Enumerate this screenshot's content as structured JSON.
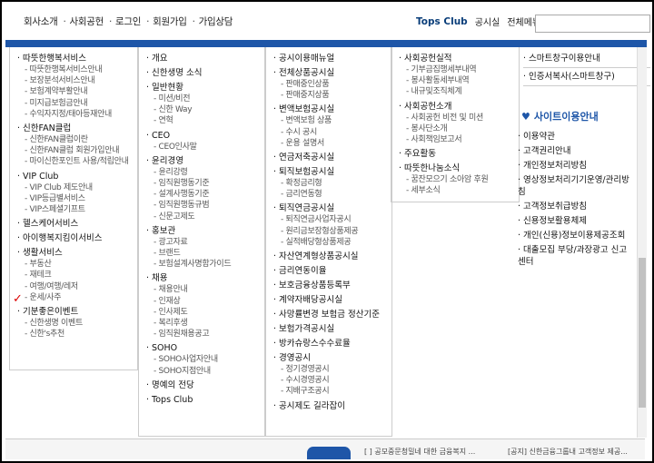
{
  "topnav": [
    "회사소개",
    "사회공헌",
    "로그인",
    "회원가입",
    "가입상담"
  ],
  "topright": {
    "tops": "Tops Club",
    "notice": "공시실",
    "menu": "전체메뉴"
  },
  "col1": [
    {
      "h": "따뜻한행복서비스",
      "subs": [
        "따뜻한행복서비스안내",
        "보장분석서비스안내",
        "보험계약부활안내",
        "미지급보험금안내",
        "수익자지정/태아등재안내"
      ]
    },
    {
      "h": "신한FAN클럽",
      "subs": [
        "신한FAN클럽이란",
        "신한FAN클럽 회원가입안내",
        "마이신한포인트 사용/적립안내"
      ]
    },
    {
      "h": "VIP Club",
      "subs": [
        "VIP Club 제도안내",
        "VIP등급별서비스",
        "VIP스페셜기프트"
      ]
    },
    {
      "h": "헬스케어서비스",
      "subs": []
    },
    {
      "h": "아이행복지킴이서비스",
      "subs": []
    },
    {
      "h": "생활서비스",
      "subs": [
        "부동산",
        "재테크",
        "여행/여행/레저",
        "운세/사주"
      ]
    },
    {
      "h": "기분좋은이벤트",
      "subs": [
        "신한생명 이벤트",
        "신한's추천"
      ]
    }
  ],
  "col2": [
    {
      "h": "개요",
      "subs": []
    },
    {
      "h": "신한생명 소식",
      "subs": []
    },
    {
      "h": "일반현황",
      "subs": [
        "미션/비전",
        "신한 Way",
        "연혁"
      ]
    },
    {
      "h": "CEO",
      "subs": [
        "CEO인사말"
      ]
    },
    {
      "h": "윤리경영",
      "subs": [
        "윤리강령",
        "임직원행동기준",
        "설계사행동기준",
        "임직원행동규범",
        "신문고제도"
      ]
    },
    {
      "h": "홍보관",
      "subs": [
        "광고자료",
        "브랜드",
        "보험설계사명함가이드"
      ]
    },
    {
      "h": "채용",
      "subs": [
        "채용안내",
        "인재상",
        "인사제도",
        "복리후생",
        "임직원채용공고"
      ]
    },
    {
      "h": "SOHO",
      "subs": [
        "SOHO사업자안내",
        "SOHO지점안내"
      ]
    },
    {
      "h": "명예의 전당",
      "subs": []
    },
    {
      "h": "Tops Club",
      "subs": []
    }
  ],
  "col3": [
    {
      "h": "공시이용매뉴얼",
      "subs": []
    },
    {
      "h": "전체상품공시실",
      "subs": [
        "판매중인상품",
        "판매중지상품"
      ]
    },
    {
      "h": "변액보험공시실",
      "subs": [
        "변액보험 상품",
        "수시 공시",
        "운용 설명서"
      ]
    },
    {
      "h": "연금저축공시실",
      "subs": []
    },
    {
      "h": "퇴직보험공시실",
      "subs": [
        "확정금리형",
        "금리연동형"
      ]
    },
    {
      "h": "퇴직연금공시실",
      "subs": [
        "퇴직연금사업자공시",
        "원리금보장형상품제공",
        "실적배당형상품제공"
      ]
    },
    {
      "h": "자산연계형상품공시실",
      "subs": []
    },
    {
      "h": "금리연동이율",
      "subs": []
    },
    {
      "h": "보호금융상품등록부",
      "subs": []
    },
    {
      "h": "계약자배당공시실",
      "subs": []
    },
    {
      "h": "사망률변경 보험금 정산기준",
      "subs": []
    },
    {
      "h": "보험가격공시실",
      "subs": []
    },
    {
      "h": "방카슈랑스수수료율",
      "subs": []
    },
    {
      "h": "경영공시",
      "subs": [
        "정기경영공시",
        "수시경영공시",
        "지배구조공시"
      ]
    },
    {
      "h": "공시제도 길라잡이",
      "subs": []
    }
  ],
  "col4": [
    {
      "h": "사회공헌실적",
      "subs": [
        "기부금집행세부내역",
        "봉사활동세부내역",
        "내규및조직체계"
      ]
    },
    {
      "h": "사회공헌소개",
      "subs": [
        "사회공헌 비전 및 미션",
        "봉사단소개",
        "사회책임보고서"
      ]
    },
    {
      "h": "주요활동",
      "subs": []
    },
    {
      "h": "따뜻한나눔소식",
      "subs": [
        "꿈잔모으기 소아암 후원",
        "세부소식"
      ]
    }
  ],
  "col5_top": [
    "스마트창구이용안내",
    "인증서복사(스마트창구)"
  ],
  "site_info_title": "사이트이용안내",
  "site_info": [
    "이용약관",
    "고객권리안내",
    "개인정보처리방침",
    "영상정보처리기기운영/관리방침",
    "고객정보취급방침",
    "신용정보활용체제",
    "개인(신용)정보이용제공조회",
    "대출모집 부당/과장광고 신고센터"
  ],
  "bottom": {
    "t1": "[ ] 공모중문청밀네 대한 금융복지 ...",
    "t2": "[공지] 신한금융그룹내 고객정보 제공..."
  }
}
